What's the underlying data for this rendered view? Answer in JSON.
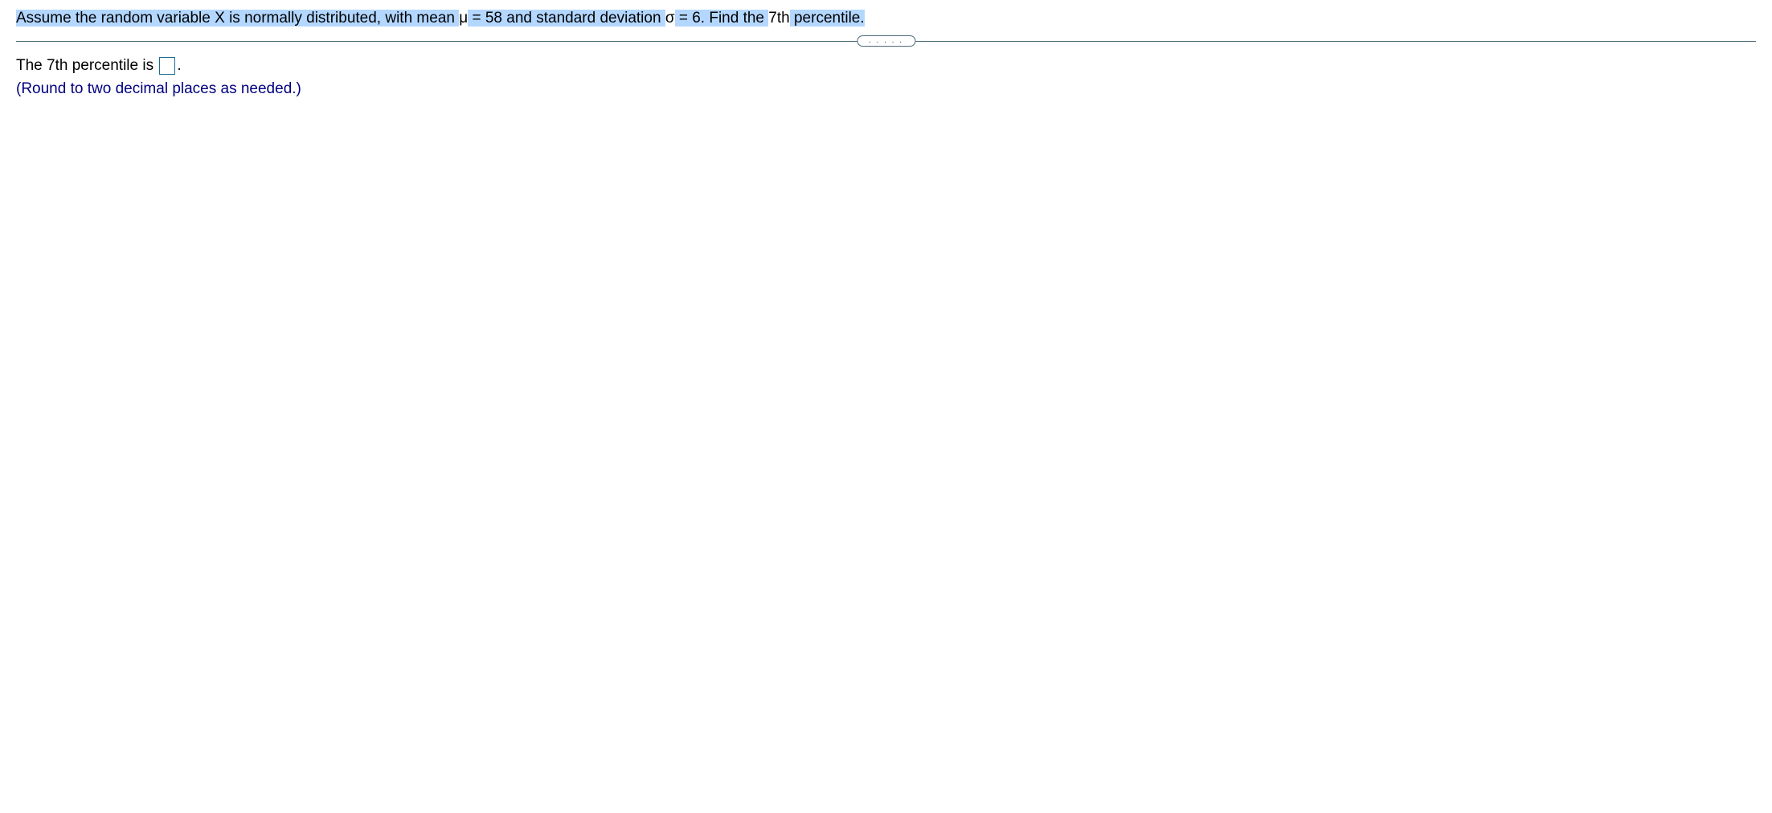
{
  "question": {
    "part1": "Assume the random variable X is normally distributed, with mean ",
    "mu_sym": "μ",
    "mu_eq": " = 58",
    "part2": " and standard deviation ",
    "sigma_sym": "σ",
    "sigma_eq": " = 6",
    "part3": ". Find the ",
    "pct": "7th",
    "part4": " percentile."
  },
  "divider_dots": ". . . . .",
  "answer": {
    "prefix": "The 7th percentile is ",
    "value": "",
    "suffix": ".",
    "instruction": "(Round to two decimal places as needed.)"
  }
}
